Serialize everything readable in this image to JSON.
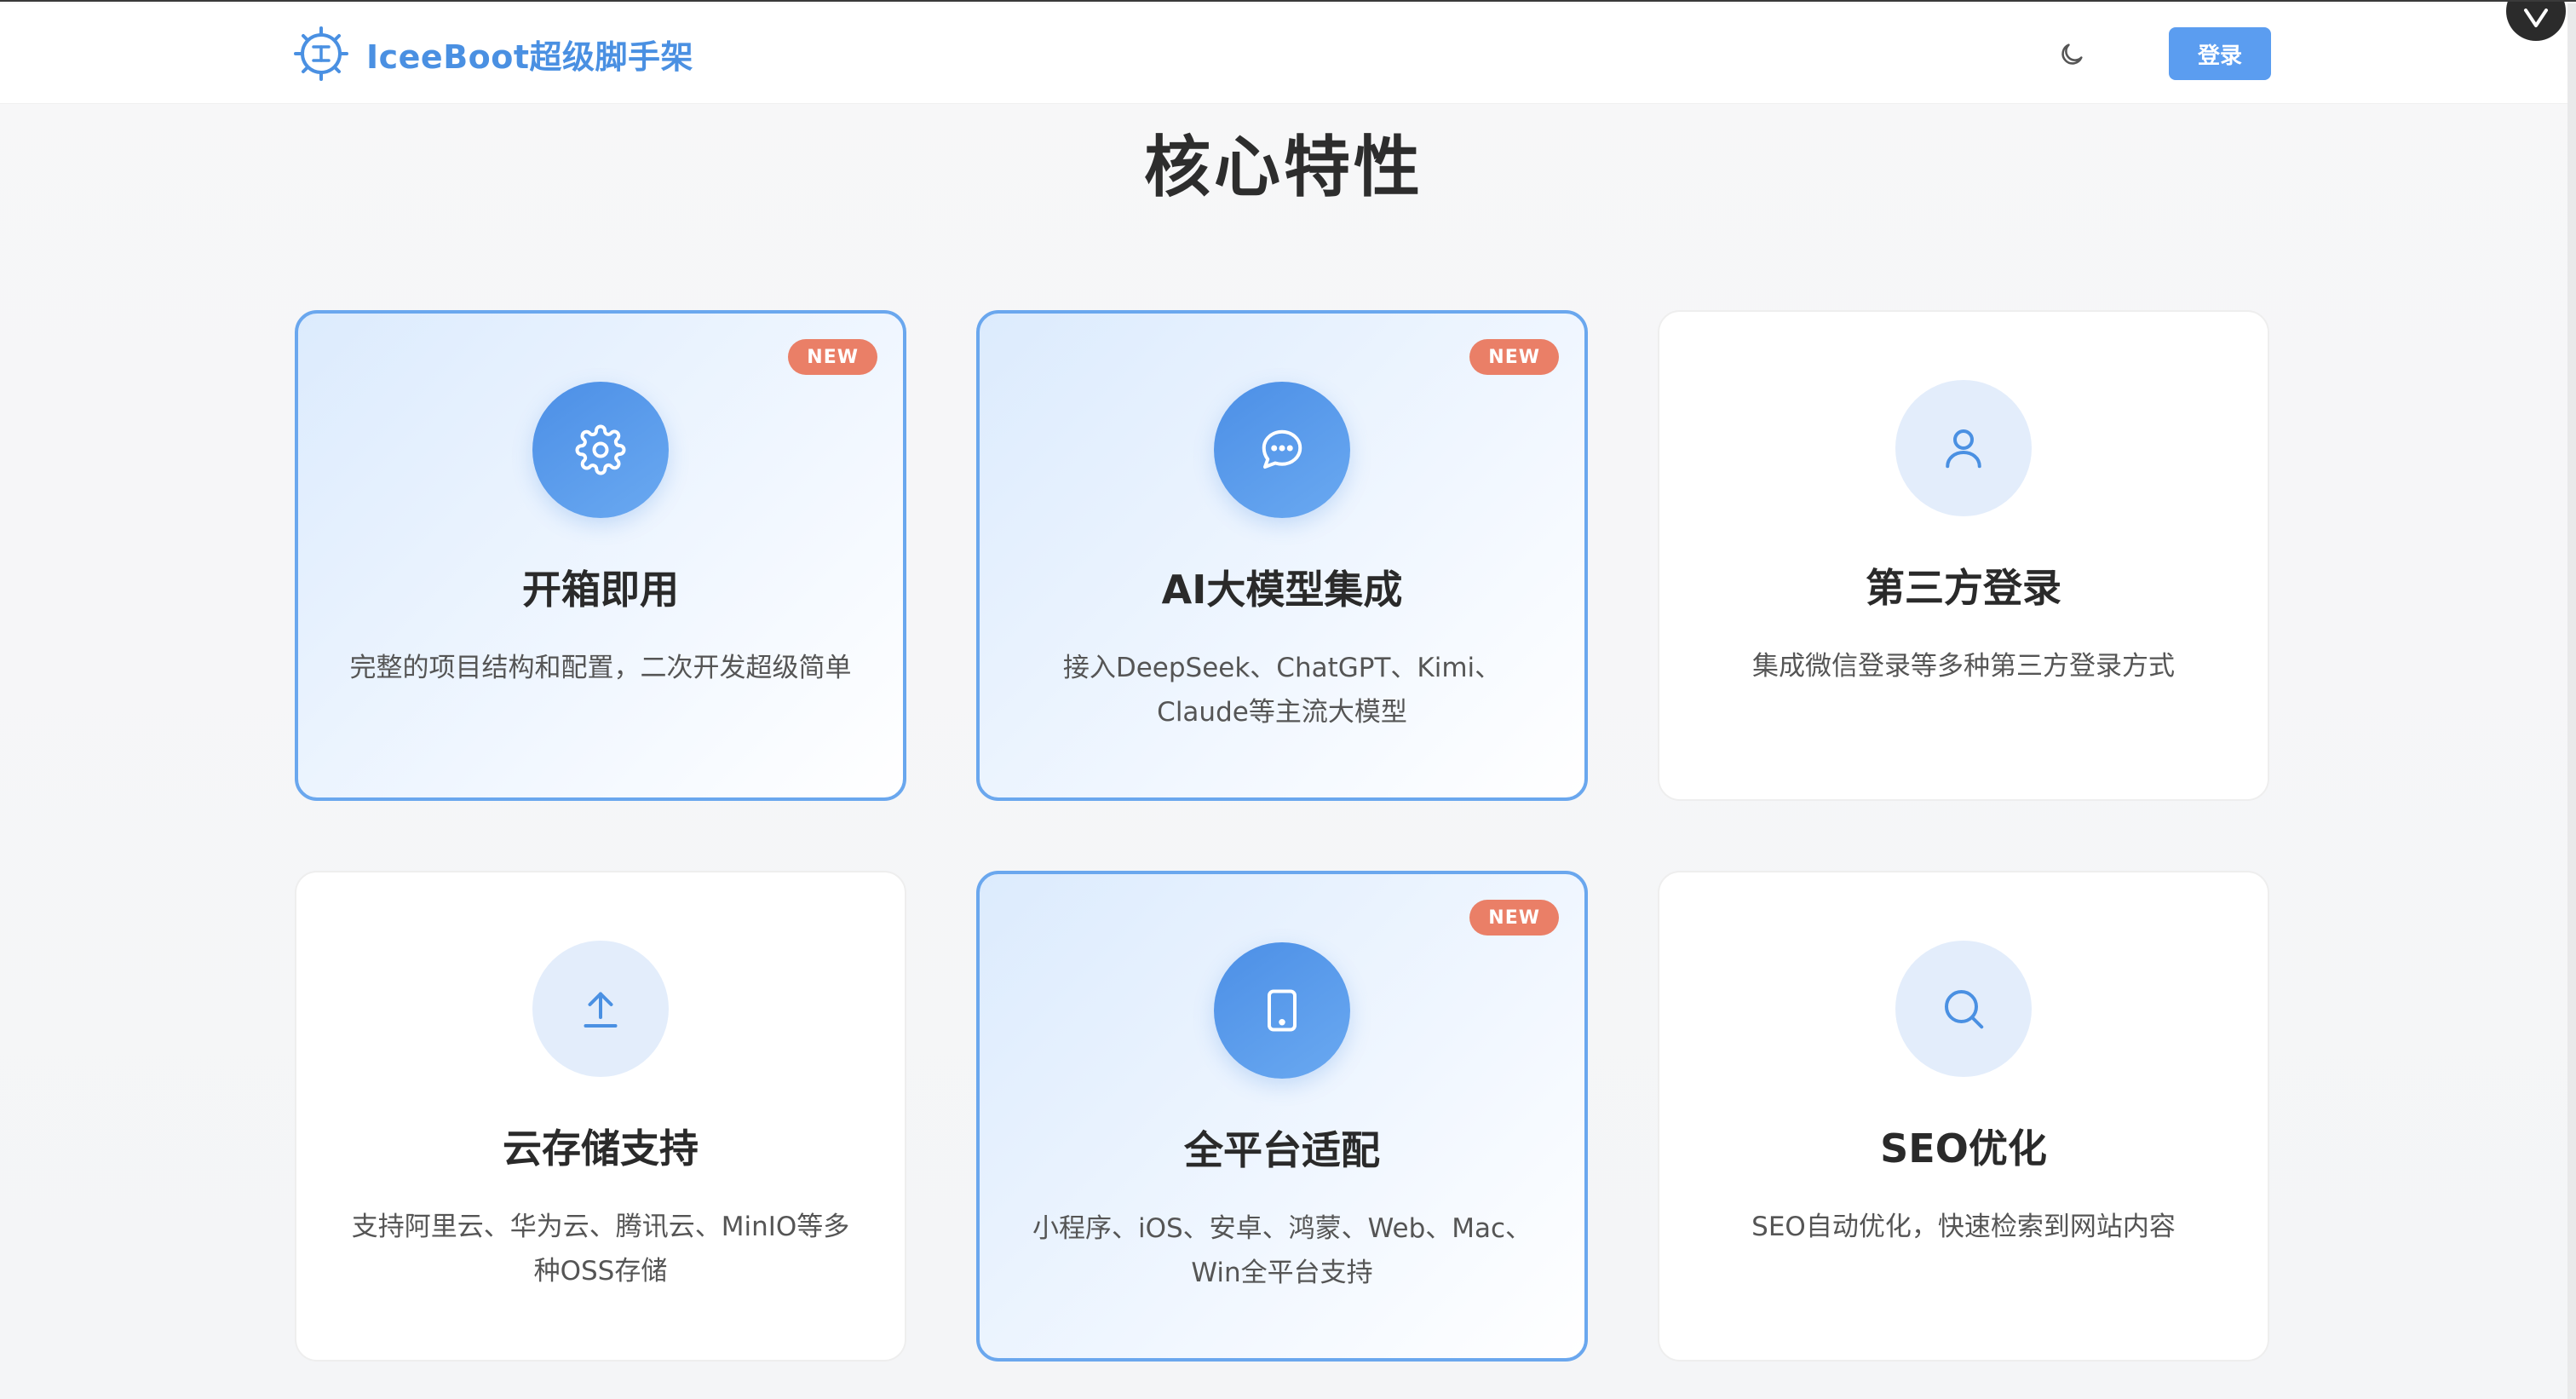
{
  "header": {
    "brand": "IceeBoot超级脚手架",
    "login_label": "登录"
  },
  "section": {
    "title": "核心特性"
  },
  "badge_label": "NEW",
  "features": [
    {
      "title": "开箱即用",
      "desc": "完整的项目结构和配置，二次开发超级简单",
      "icon": "gear-icon",
      "is_new": true
    },
    {
      "title": "AI大模型集成",
      "desc": "接入DeepSeek、ChatGPT、Kimi、Claude等主流大模型",
      "icon": "chat-bubble-icon",
      "is_new": true
    },
    {
      "title": "第三方登录",
      "desc": "集成微信登录等多种第三方登录方式",
      "icon": "user-icon",
      "is_new": false
    },
    {
      "title": "云存储支持",
      "desc": "支持阿里云、华为云、腾讯云、MinIO等多种OSS存储",
      "icon": "upload-icon",
      "is_new": false
    },
    {
      "title": "全平台适配",
      "desc": "小程序、iOS、安卓、鸿蒙、Web、Mac、Win全平台支持",
      "icon": "tablet-icon",
      "is_new": true
    },
    {
      "title": "SEO优化",
      "desc": "SEO自动优化，快速检索到网站内容",
      "icon": "search-icon",
      "is_new": false
    }
  ],
  "colors": {
    "accent": "#4a90e2",
    "badge": "#ea7f67"
  }
}
